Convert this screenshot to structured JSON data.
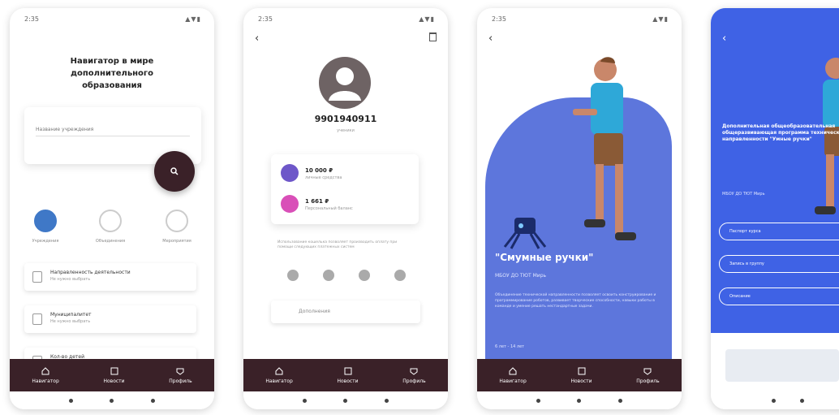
{
  "colors": {
    "accent_dark": "#3a2128",
    "accent_blue": "#3f78c7",
    "panel_blue": "#5d76dc",
    "bright_blue": "#3f62e5"
  },
  "bottom_nav": [
    {
      "label": "Навигатор",
      "icon": "home-icon"
    },
    {
      "label": "Новости",
      "icon": "news-icon"
    },
    {
      "label": "Профиль",
      "icon": "profile-icon"
    }
  ],
  "screen1": {
    "title": "Навигатор в мире дополнительного образования",
    "search_placeholder": "Название учреждения",
    "radio_options": [
      {
        "label": "Учреждения",
        "selected": true
      },
      {
        "label": "Объединения",
        "selected": false
      },
      {
        "label": "Мероприятия",
        "selected": false
      }
    ],
    "list": [
      {
        "title": "Направленность деятельности",
        "sub": "Не нужно выбрать"
      },
      {
        "title": "Муниципалитет",
        "sub": "Не нужно выбрать"
      },
      {
        "title": "Кол-во детей",
        "sub": ""
      }
    ]
  },
  "screen2": {
    "phone": "9901940911",
    "subtitle": "ученики",
    "balances": [
      {
        "amount": "10 000 ₽",
        "label": "личные средства"
      },
      {
        "amount": "1 661 ₽",
        "label": "Персональный баланс"
      }
    ],
    "note": "Использование кошелька позволяет производить оплату при помощи следующих платежных систем",
    "support": "Дополнения"
  },
  "screen3": {
    "title": "\"Cмумные ручки\"",
    "subtitle": "МБОУ ДО ТЮТ Мирь",
    "description": "Объединение технической направленности позволяет освоить конструирование и программирование роботов, развивает творческие способности, навыки работы в команде и умение решать нестандартные задачи.",
    "age": "6 лет - 14 лет"
  },
  "screen4": {
    "text": "Дополнительная общеобразовательная общеразвивающая программа технической направленности \"Умные ручки\"",
    "org": "МБОУ ДО ТЮТ Мирь",
    "buttons": [
      "Паспорт курса",
      "Запись в группу",
      "Описание"
    ]
  }
}
